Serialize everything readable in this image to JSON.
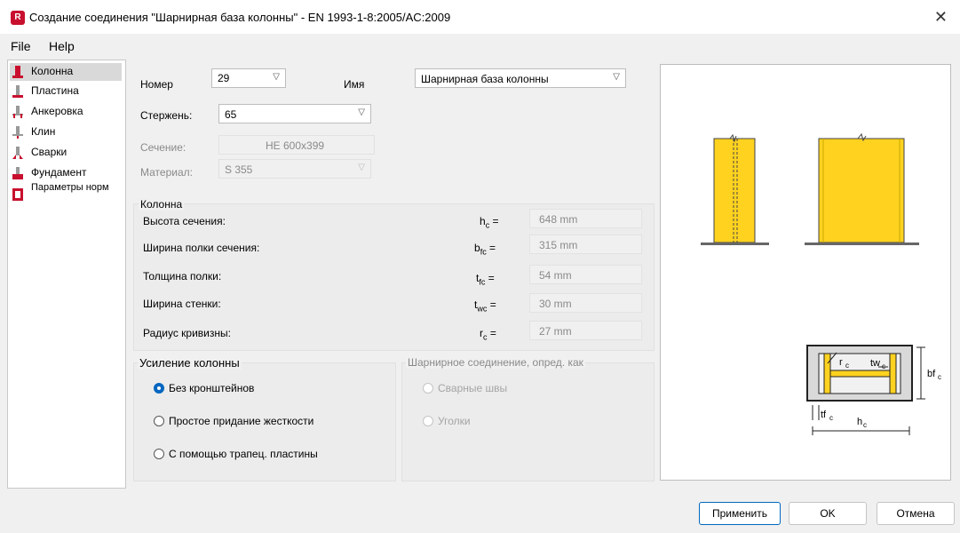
{
  "window": {
    "app_icon": "R",
    "title": "Создание соединения \"Шарнирная база колонны\" - EN 1993-1-8:2005/AC:2009",
    "close": "✕"
  },
  "menu": [
    "File",
    "Help"
  ],
  "sidebar": {
    "items": [
      {
        "label": "Колонна",
        "icon": "column-icon",
        "selected": true
      },
      {
        "label": "Пластина",
        "icon": "plate-icon"
      },
      {
        "label": "Анкеровка",
        "icon": "anchor-icon"
      },
      {
        "label": "Клин",
        "icon": "wedge-icon"
      },
      {
        "label": "Сварки",
        "icon": "weld-icon"
      },
      {
        "label": "Фундамент",
        "icon": "foundation-icon"
      },
      {
        "label": "Параметры норм",
        "icon": "code-params-icon"
      }
    ]
  },
  "form": {
    "number_label": "Номер",
    "number_value": "29",
    "name_label": "Имя",
    "name_value": "Шарнирная база колонны",
    "bar_label": "Стержень:",
    "bar_value": "65",
    "section_label": "Сечение:",
    "section_value": "HE 600x399",
    "material_label": "Материал:",
    "material_value": "S 355"
  },
  "column_group": {
    "title": "Колонна",
    "rows": [
      {
        "label": "Высота сечения:",
        "symbol": "h",
        "sub": "c",
        "value": "648 mm"
      },
      {
        "label": "Ширина полки сечения:",
        "symbol": "b",
        "sub": "fc",
        "value": "315 mm"
      },
      {
        "label": "Толщина полки:",
        "symbol": "t",
        "sub": "fc",
        "value": "54 mm"
      },
      {
        "label": "Ширина стенки:",
        "symbol": "t",
        "sub": "wc",
        "value": "30 mm"
      },
      {
        "label": "Радиус кривизны:",
        "symbol": "r",
        "sub": "c",
        "value": "27 mm"
      }
    ],
    "eq": "="
  },
  "reinforcement": {
    "title": "Усиление колонны",
    "options": [
      "Без кронштейнов",
      "Простое придание жесткости",
      "С помощью трапец. пластины"
    ],
    "selected": 0
  },
  "hinge": {
    "title": "Шарнирное соединение, опред. как",
    "options": [
      "Сварные швы",
      "Уголки"
    ]
  },
  "preview": {
    "section_labels": {
      "rc": "r",
      "rc_sub": "c",
      "twc": "tw",
      "twc_sub": "c",
      "bfc": "bf",
      "bfc_sub": "c",
      "tfc": "tf",
      "tfc_sub": "c",
      "hc": "h",
      "hc_sub": "c"
    },
    "colors": {
      "column": "#ffd21f",
      "column_dark": "#e8b800",
      "section_bg": "#d9d9d9"
    }
  },
  "buttons": {
    "apply": "Применить",
    "ok": "OK",
    "cancel": "Отмена"
  }
}
